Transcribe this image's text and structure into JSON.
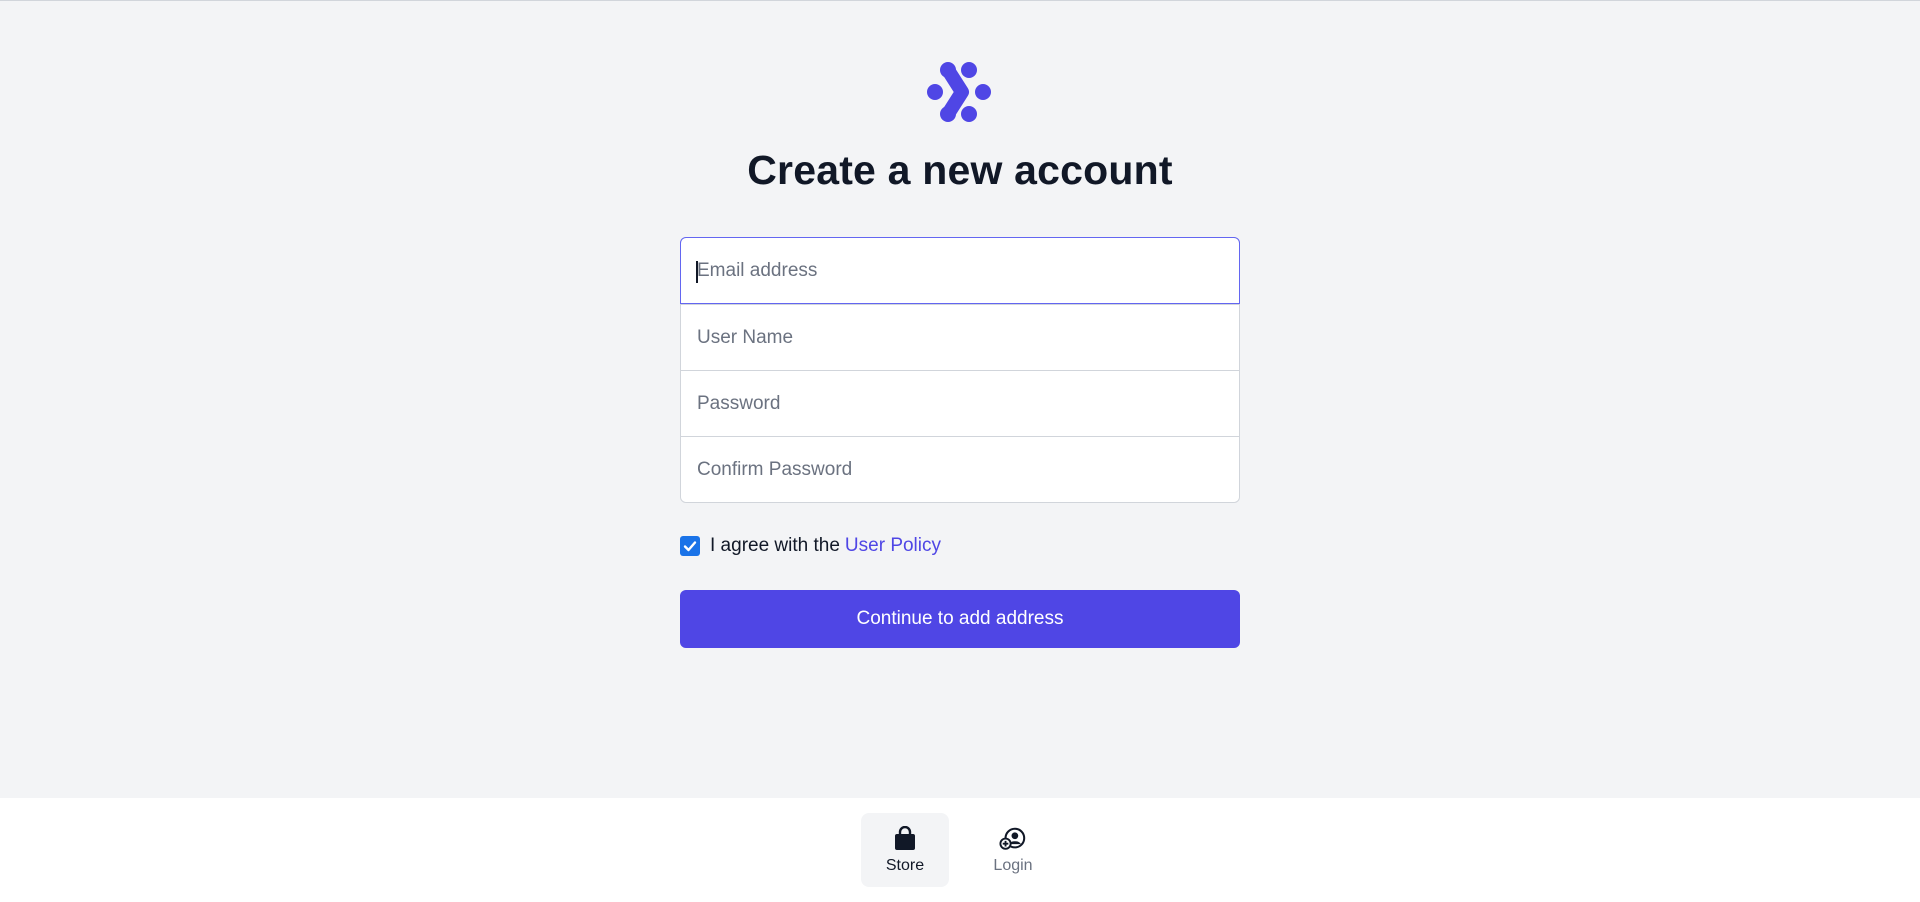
{
  "colors": {
    "accent": "#4f46e5",
    "background": "#f3f4f6",
    "checkbox": "#1a73e8"
  },
  "logo": {
    "icon": "logo-icon"
  },
  "page": {
    "title": "Create a new account"
  },
  "form": {
    "email": {
      "placeholder": "Email address",
      "value": ""
    },
    "username": {
      "placeholder": "User Name",
      "value": ""
    },
    "password": {
      "placeholder": "Password",
      "value": ""
    },
    "confirm_password": {
      "placeholder": "Confirm Password",
      "value": ""
    }
  },
  "agree": {
    "checked": true,
    "text": "I agree with the",
    "link_text": "User Policy"
  },
  "submit_label": "Continue to add address",
  "bottom_nav": {
    "items": [
      {
        "label": "Store",
        "icon": "shopping-bag-icon",
        "active": true
      },
      {
        "label": "Login",
        "icon": "user-add-icon",
        "active": false
      }
    ]
  }
}
